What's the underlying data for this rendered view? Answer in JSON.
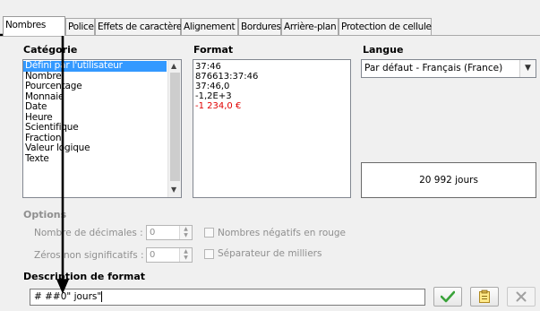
{
  "tabs": [
    {
      "label": "Nombres",
      "active": true
    },
    {
      "label": "Police"
    },
    {
      "label": "Effets de caractère"
    },
    {
      "label": "Alignement"
    },
    {
      "label": "Bordures"
    },
    {
      "label": "Arrière-plan"
    },
    {
      "label": "Protection de cellule"
    }
  ],
  "category": {
    "label": "Catégorie",
    "items": [
      "Défini par l'utilisateur",
      "Nombre",
      "Pourcentage",
      "Monnaie",
      "Date",
      "Heure",
      "Scientifique",
      "Fraction",
      "Valeur logique",
      "Texte"
    ],
    "selected_index": 0
  },
  "format": {
    "label": "Format",
    "items": [
      {
        "text": "37:46",
        "color": "#000000"
      },
      {
        "text": "876613:37:46",
        "color": "#000000"
      },
      {
        "text": "37:46,0",
        "color": "#000000"
      },
      {
        "text": "-1,2E+3",
        "color": "#000000"
      },
      {
        "text": "-1 234,0 €",
        "color": "#e00000"
      }
    ]
  },
  "language": {
    "label": "Langue",
    "value": "Par défaut - Français (France)"
  },
  "preview": {
    "text": "20 992 jours"
  },
  "options": {
    "label": "Options",
    "decimals_label": "Nombre de décimales :",
    "decimals_value": "0",
    "leading_zeros_label": "Zéros non significatifs :",
    "leading_zeros_value": "0",
    "negative_red_label": "Nombres négatifs en rouge",
    "thousands_sep_label": "Séparateur de milliers"
  },
  "format_code": {
    "label": "Description de format",
    "value": "# ##0\" jours\""
  },
  "colors": {
    "selection": "#3399ff",
    "negative": "#e00000",
    "check_green": "#3aa33a",
    "annotation_arrow": "#000000"
  }
}
